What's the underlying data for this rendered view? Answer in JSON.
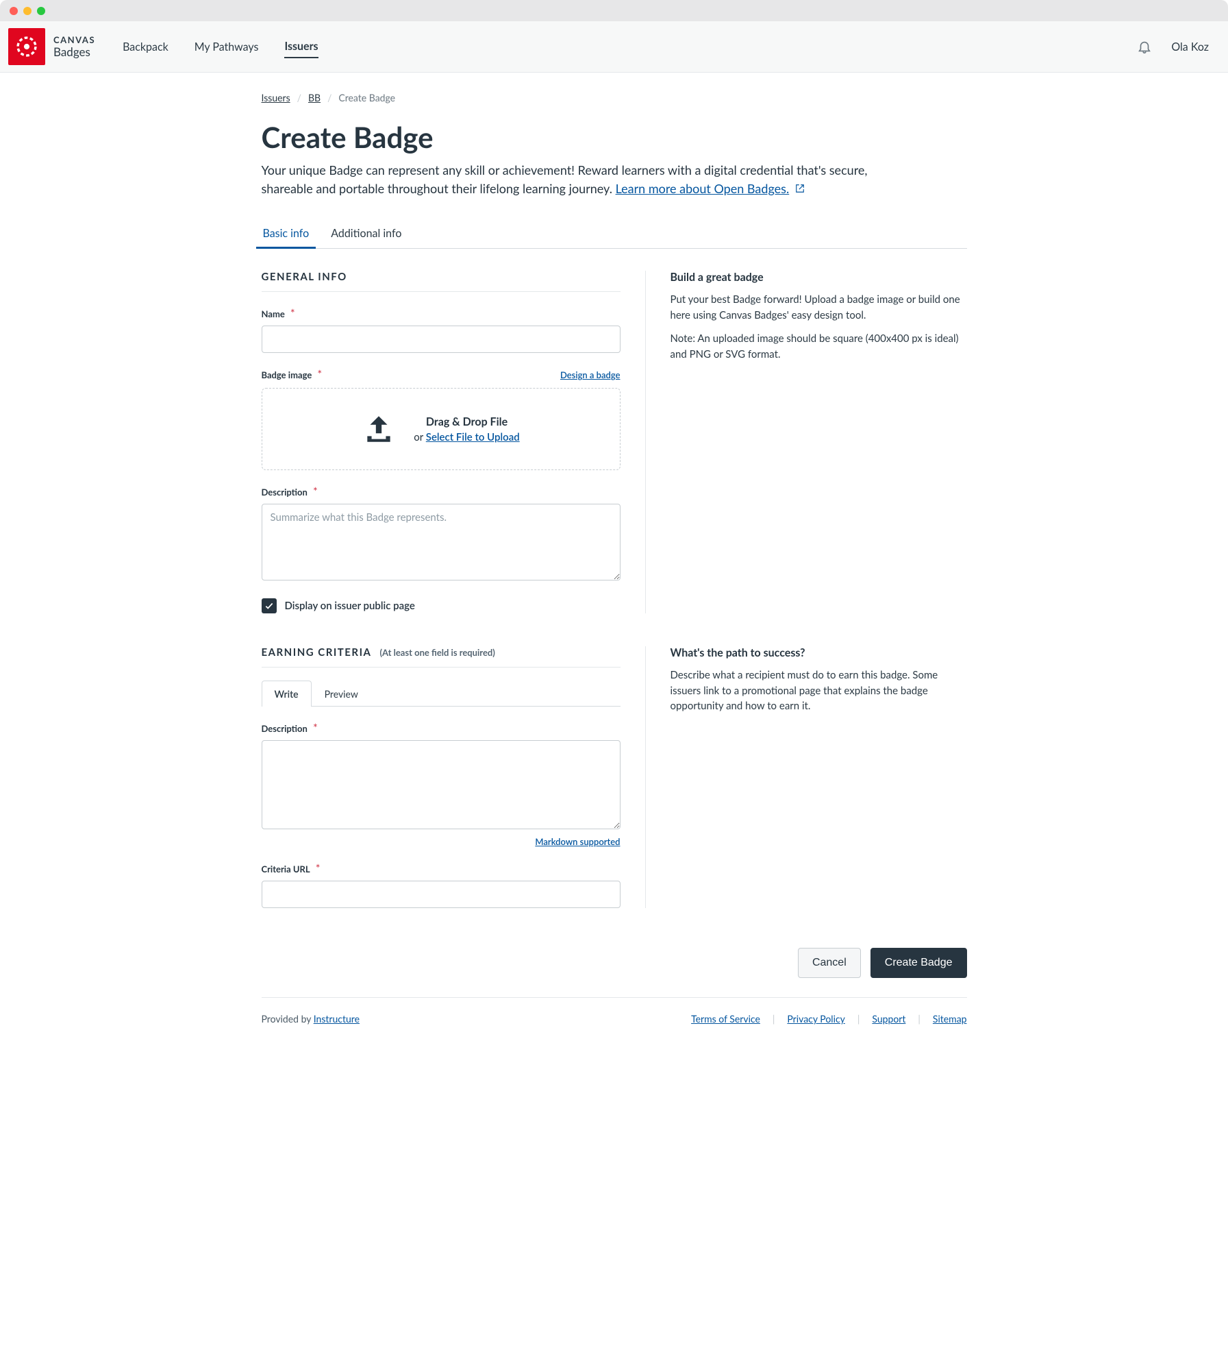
{
  "brand": {
    "name_line1": "CANVAS",
    "name_line2": "Badges"
  },
  "nav": {
    "items": [
      "Backpack",
      "My Pathways",
      "Issuers"
    ],
    "active": "Issuers"
  },
  "user": {
    "name": "Ola Koz"
  },
  "breadcrumb": {
    "items": [
      "Issuers",
      "BB"
    ],
    "current": "Create Badge"
  },
  "page": {
    "title": "Create Badge",
    "description": "Your unique Badge can represent any skill or achievement! Reward learners with a digital credential that's secure, shareable and portable throughout their lifelong learning journey.",
    "learn_more": "Learn more about Open Badges."
  },
  "tabs": {
    "items": [
      "Basic info",
      "Additional info"
    ],
    "active": "Basic info"
  },
  "general": {
    "section_title": "General Info",
    "name_label": "Name",
    "name_value": "",
    "badge_image_label": "Badge image",
    "design_link": "Design a badge",
    "drop_title": "Drag & Drop File",
    "drop_or": "or ",
    "drop_select": "Select File to Upload",
    "description_label": "Description",
    "description_placeholder": "Summarize what this Badge represents.",
    "description_value": "",
    "display_public_label": "Display on issuer public page",
    "display_public_checked": true
  },
  "earning": {
    "section_title": "Earning Criteria",
    "hint": "(At least one field is required)",
    "editor_tabs": [
      "Write",
      "Preview"
    ],
    "editor_active": "Write",
    "description_label": "Description",
    "description_value": "",
    "markdown_hint": "Markdown supported",
    "url_label": "Criteria URL",
    "url_value": ""
  },
  "help": {
    "general": {
      "title": "Build a great badge",
      "p1": "Put your best Badge forward! Upload a badge image or build one here using Canvas Badges' easy design tool.",
      "p2": "Note: An uploaded image should be square (400x400 px is ideal) and PNG or SVG format."
    },
    "earning": {
      "title": "What's the path to success?",
      "p1": "Describe what a recipient must do to earn this badge. Some issuers link to a promotional page that explains the badge opportunity and how to earn it."
    }
  },
  "actions": {
    "cancel": "Cancel",
    "create": "Create Badge"
  },
  "footer": {
    "provided_by": "Provided by ",
    "provider": "Instructure",
    "links": [
      "Terms of Service",
      "Privacy Policy",
      "Support",
      "Sitemap"
    ]
  }
}
